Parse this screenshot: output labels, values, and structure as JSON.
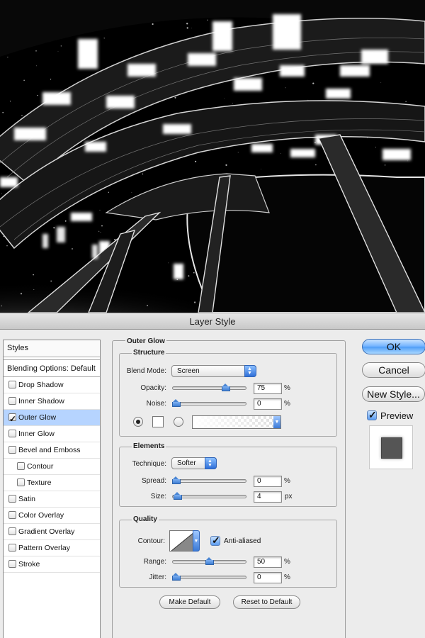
{
  "dialog": {
    "title": "Layer Style",
    "styles_header": "Styles",
    "blending_options": "Blending Options: Default",
    "style_items": [
      {
        "label": "Drop Shadow",
        "checked": false
      },
      {
        "label": "Inner Shadow",
        "checked": false
      },
      {
        "label": "Outer Glow",
        "checked": true,
        "active": true
      },
      {
        "label": "Inner Glow",
        "checked": false
      },
      {
        "label": "Bevel and Emboss",
        "checked": false
      },
      {
        "label": "Contour",
        "checked": false,
        "sub": true
      },
      {
        "label": "Texture",
        "checked": false,
        "sub": true
      },
      {
        "label": "Satin",
        "checked": false
      },
      {
        "label": "Color Overlay",
        "checked": false
      },
      {
        "label": "Gradient Overlay",
        "checked": false
      },
      {
        "label": "Pattern Overlay",
        "checked": false
      },
      {
        "label": "Stroke",
        "checked": false
      }
    ]
  },
  "outer_glow": {
    "title": "Outer Glow",
    "structure": {
      "title": "Structure",
      "blend_mode_label": "Blend Mode:",
      "blend_mode_value": "Screen",
      "opacity_label": "Opacity:",
      "opacity_value": "75",
      "opacity_fraction": 0.75,
      "opacity_unit": "%",
      "noise_label": "Noise:",
      "noise_value": "0",
      "noise_fraction": 0,
      "noise_unit": "%"
    },
    "elements": {
      "title": "Elements",
      "technique_label": "Technique:",
      "technique_value": "Softer",
      "spread_label": "Spread:",
      "spread_value": "0",
      "spread_fraction": 0,
      "spread_unit": "%",
      "size_label": "Size:",
      "size_value": "4",
      "size_fraction": 0.02,
      "size_unit": "px"
    },
    "quality": {
      "title": "Quality",
      "contour_label": "Contour:",
      "anti_aliased_label": "Anti-aliased",
      "anti_aliased": true,
      "range_label": "Range:",
      "range_value": "50",
      "range_fraction": 0.5,
      "range_unit": "%",
      "jitter_label": "Jitter:",
      "jitter_value": "0",
      "jitter_fraction": 0,
      "jitter_unit": "%"
    },
    "make_default": "Make Default",
    "reset_default": "Reset to Default"
  },
  "buttons": {
    "ok": "OK",
    "cancel": "Cancel",
    "new_style": "New Style...",
    "preview_label": "Preview",
    "preview_checked": true
  },
  "colors": {
    "accent": "#4d9cf7",
    "selection": "#b6d4ff",
    "dialog_bg": "#ececec"
  }
}
